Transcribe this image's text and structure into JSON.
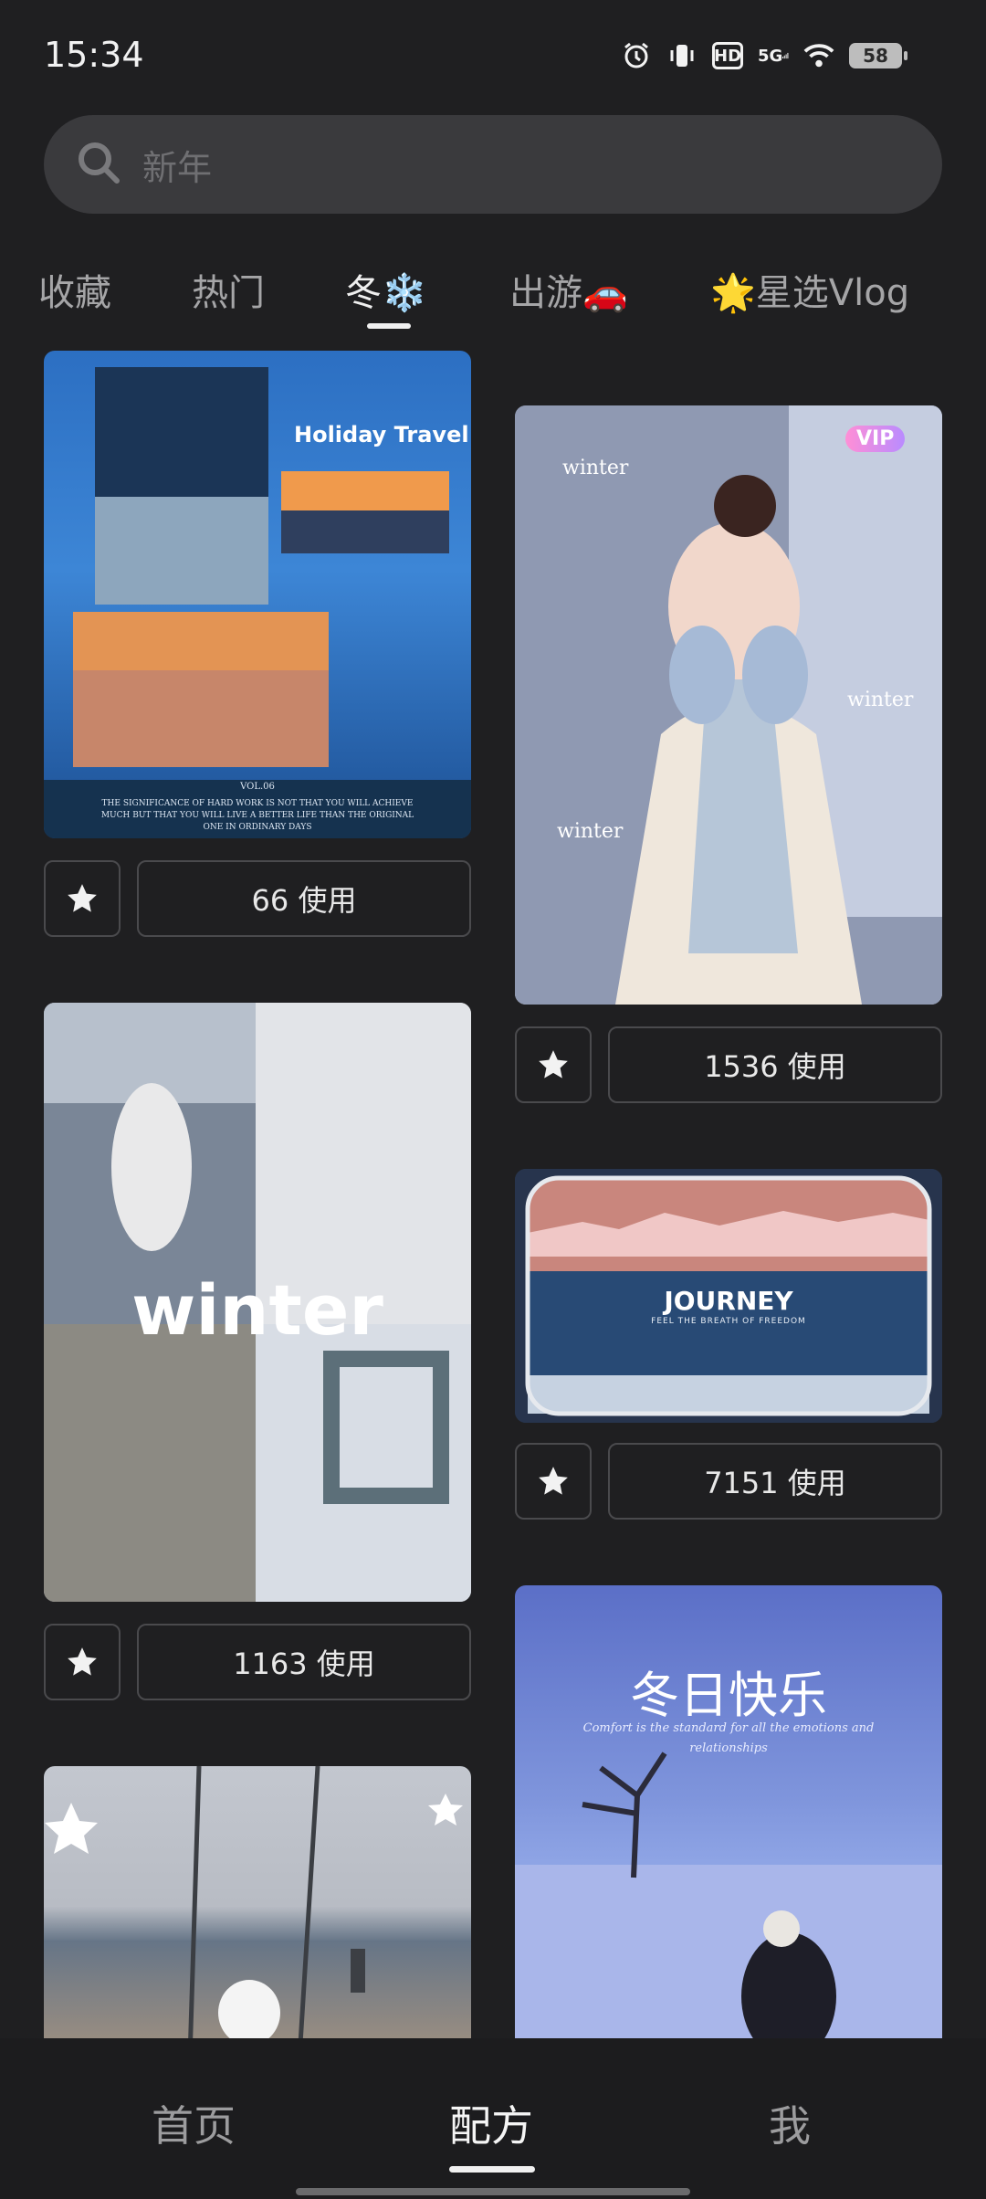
{
  "status": {
    "time": "15:34",
    "hd": "HD",
    "network": "5G",
    "battery": "58"
  },
  "search": {
    "placeholder": "新年"
  },
  "tabs": [
    {
      "label": "收藏"
    },
    {
      "label": "热门"
    },
    {
      "label": "冬❄️"
    },
    {
      "label": "出游🚗"
    },
    {
      "label": "🌟星选Vlog"
    }
  ],
  "cards": [
    {
      "overlay_title": "Holiday Travel",
      "overlay_vol": "VOL.06",
      "overlay_quote": "THE SIGNIFICANCE OF HARD WORK IS NOT THAT YOU WILL ACHIEVE MUCH BUT THAT YOU WILL LIVE A BETTER LIFE THAN THE ORIGINAL ONE IN ORDINARY DAYS",
      "uses": "66 使用"
    },
    {
      "badge": "VIP",
      "overlay_word": "winter",
      "uses": "1536 使用"
    },
    {
      "overlay_title": "winter",
      "uses": "1163 使用"
    },
    {
      "overlay_title": "JOURNEY",
      "overlay_sub": "FEEL THE BREATH OF FREEDOM",
      "uses": "7151 使用"
    },
    {},
    {
      "overlay_title": "冬日快乐",
      "overlay_sub": "Comfort is the standard for all the emotions and relationships"
    }
  ],
  "nav": [
    {
      "label": "首页"
    },
    {
      "label": "配方"
    },
    {
      "label": "我"
    }
  ],
  "colors": {
    "background": "#1f1f21",
    "search_bg": "#3a3a3d",
    "active_text": "#efefef",
    "inactive_text": "#a5a5a7"
  }
}
